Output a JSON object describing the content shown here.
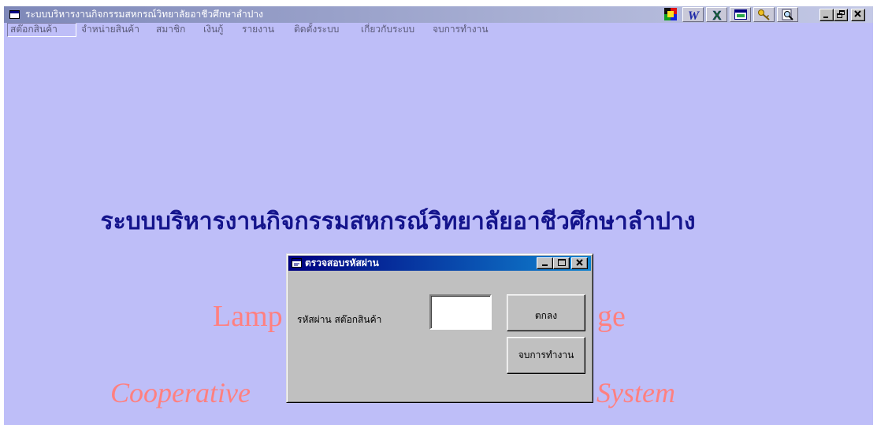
{
  "window": {
    "title": "ระบบบริหารงานกิจกรรมสหกรณ์วิทยาลัยอาชีวศึกษาลำปาง",
    "icon": "app-icon",
    "controls": [
      "minimize-icon",
      "restore-icon",
      "close-icon"
    ]
  },
  "toolbar": {
    "icons": [
      "office-logo-icon",
      "word-icon",
      "excel-icon",
      "window-icon",
      "key-icon",
      "search-icon"
    ],
    "word_glyph": "W",
    "excel_glyph": "X"
  },
  "menu": {
    "items": [
      {
        "label": "สต๊อกสินค้า",
        "active": true
      },
      {
        "label": "จำหน่ายสินค้า",
        "active": false
      },
      {
        "label": "สมาชิก",
        "active": false
      },
      {
        "label": "เงินกู้",
        "active": false
      },
      {
        "label": "รายงาน",
        "active": false
      },
      {
        "label": "ติดตั้งระบบ",
        "active": false
      },
      {
        "label": "เกี่ยวกับระบบ",
        "active": false
      },
      {
        "label": "จบการทำงาน",
        "active": false
      }
    ]
  },
  "splash": {
    "heading": "ระบบบริหารงานกิจกรรมสหกรณ์วิทยาลัยอาชีวศึกษาลำปาง",
    "line2_visible_start": "Lamp",
    "line2_visible_end": "ge",
    "line3_visible_start": "Cooperative",
    "line3_visible_end": "System"
  },
  "dialog": {
    "title": "ตรวจสอบรหัสผ่าน",
    "icon": "form-icon",
    "controls": [
      "minimize-icon",
      "maximize-icon",
      "close-icon"
    ],
    "password_label": "รหัสผ่าน สต๊อกสินค้า",
    "password_value": "",
    "ok_label": "ตกลง",
    "exit_label": "จบการทำงาน"
  },
  "colors": {
    "client_background": "#bebef8",
    "heading_text": "#14148c",
    "accent_text": "#ff8080",
    "dialog_title_start": "#000080",
    "dialog_title_end": "#1084d0",
    "dialog_face": "#c0c0c0"
  }
}
